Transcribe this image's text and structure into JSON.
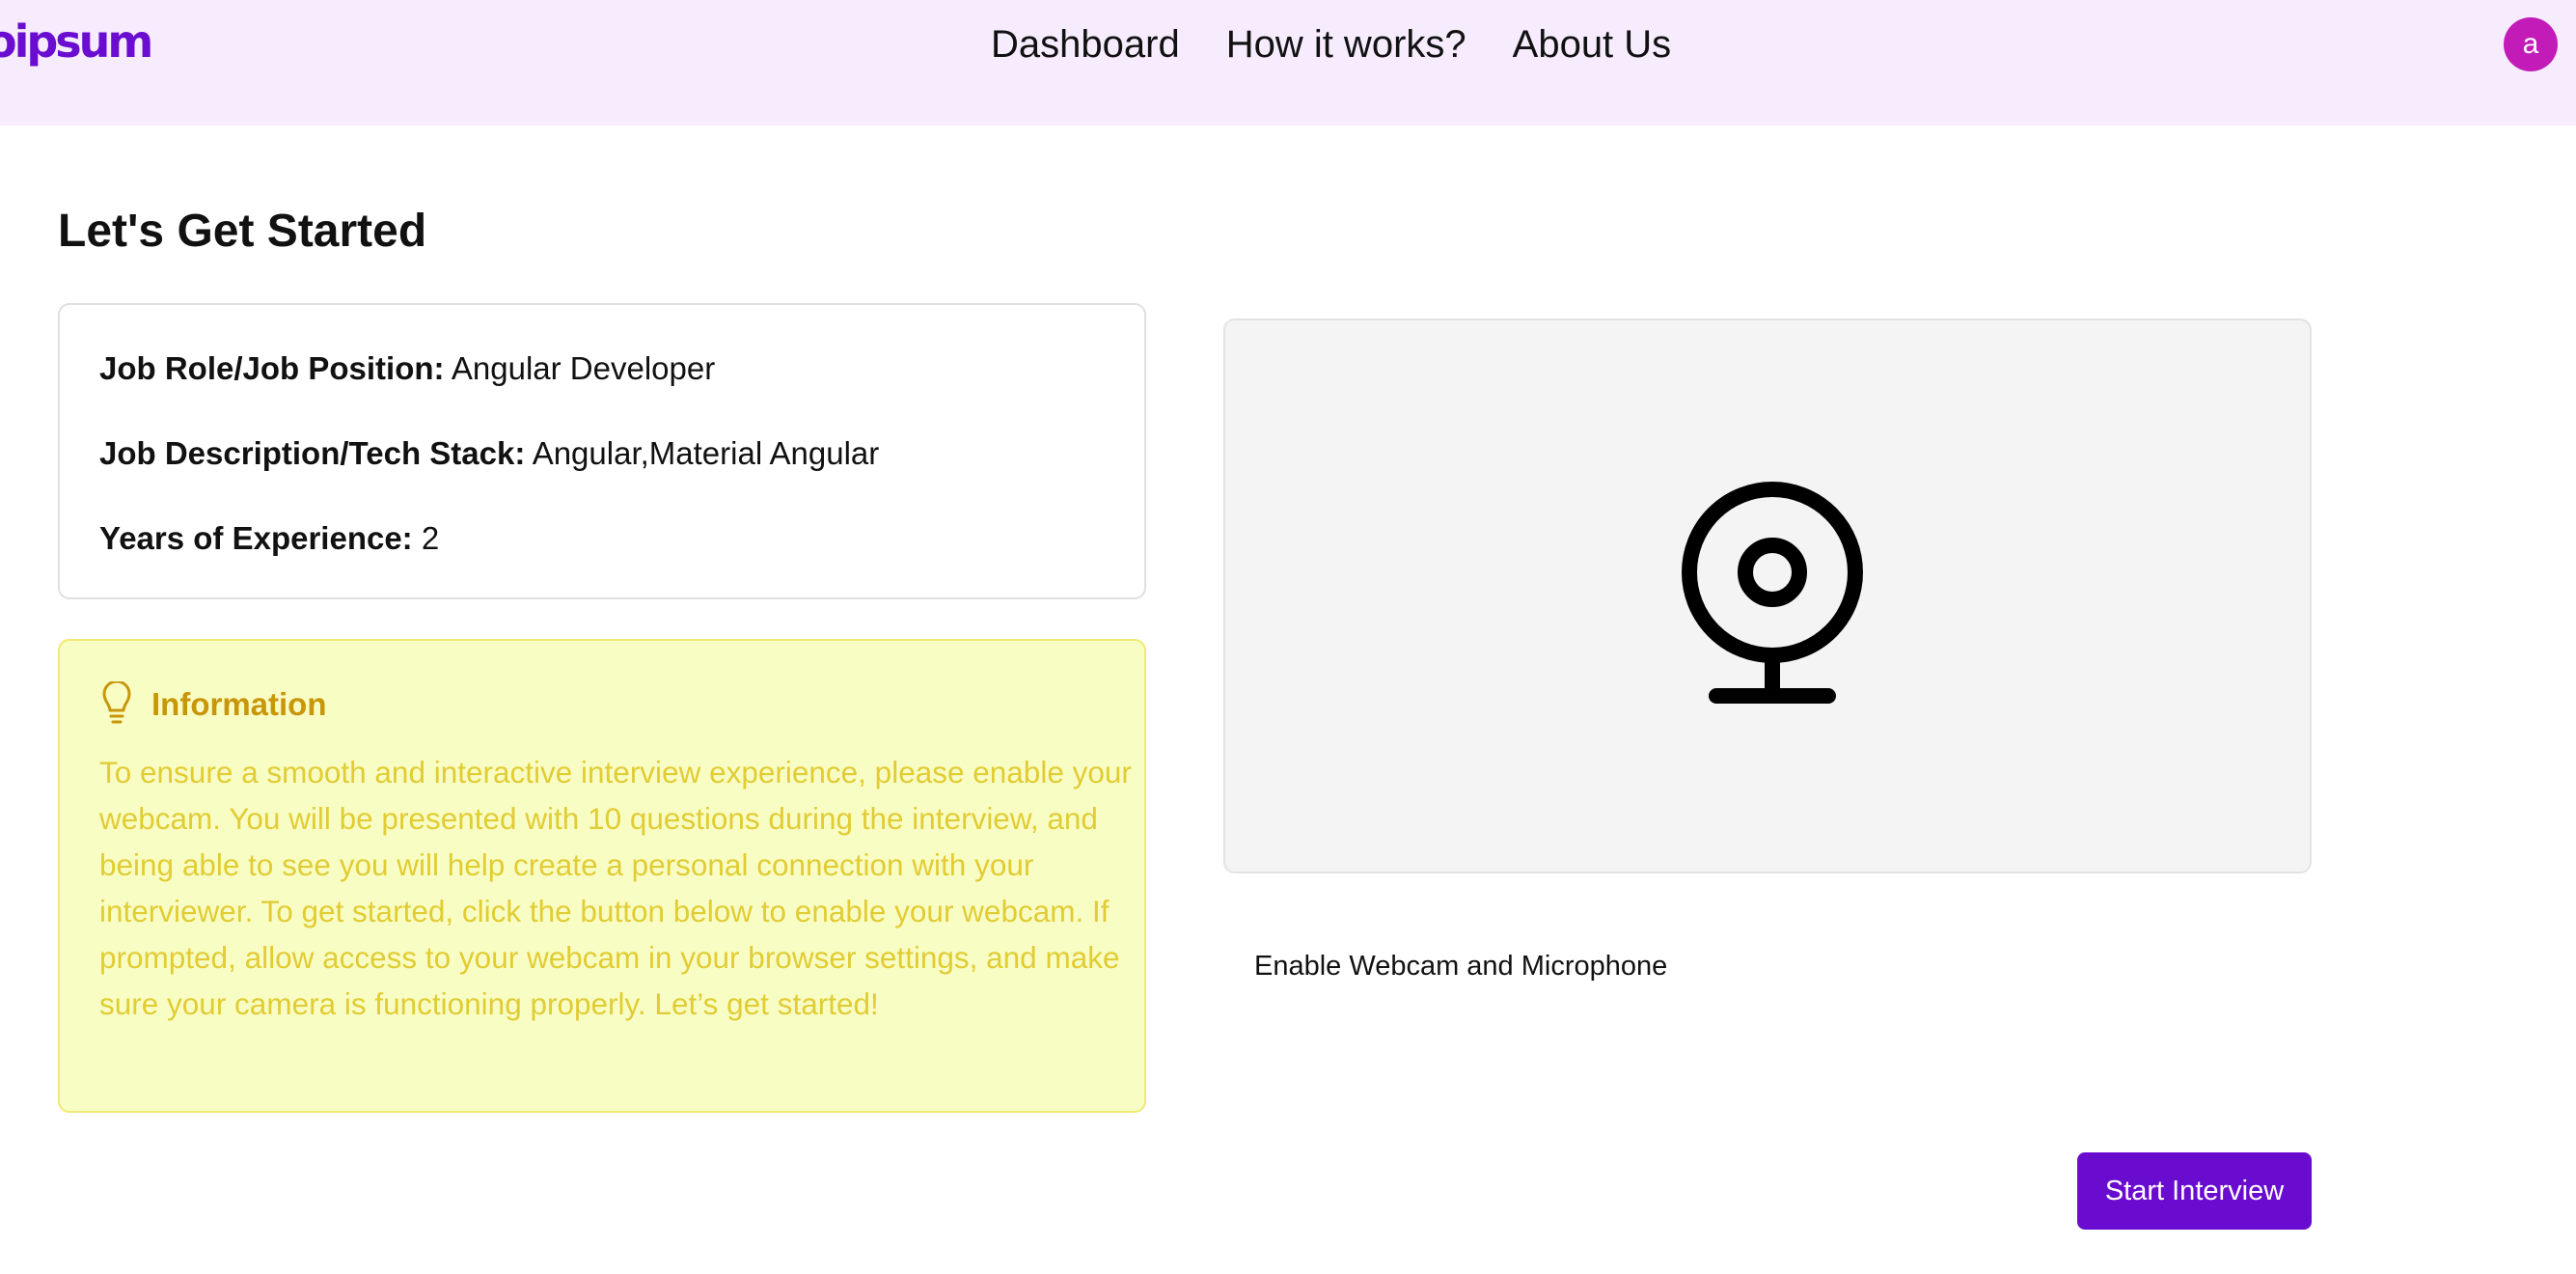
{
  "header": {
    "logo_text": "oipsum",
    "nav": [
      "Dashboard",
      "How it works?",
      "About Us"
    ],
    "avatar_initial": "a"
  },
  "page_title": "Let's Get Started",
  "job_details": {
    "role_label": "Job Role/Job Position:",
    "role_value": "Angular Developer",
    "description_label": "Job Description/Tech Stack:",
    "description_value": "Angular,Material Angular",
    "experience_label": "Years of Experience:",
    "experience_value": "2"
  },
  "information": {
    "icon": "lightbulb-icon",
    "title": "Information",
    "text": "To ensure a smooth and interactive interview experience, please enable your webcam. You will be presented with 10 questions during the interview, and being able to see you will help create a personal connection with your interviewer. To get started, click the button below to enable your webcam. If prompted, allow access to your webcam in your browser settings, and make sure your camera is functioning properly. Let’s get started!"
  },
  "webcam": {
    "icon": "webcam-icon",
    "enable_button_label": "Enable Webcam and Microphone"
  },
  "start_button_label": "Start Interview",
  "colors": {
    "brand": "#6a0ccf",
    "header_bg": "#f6ecfd",
    "avatar_bg": "#c21bb8",
    "info_bg": "#f8fdc4",
    "info_title": "#c8960a",
    "info_text": "#e1cc34"
  }
}
